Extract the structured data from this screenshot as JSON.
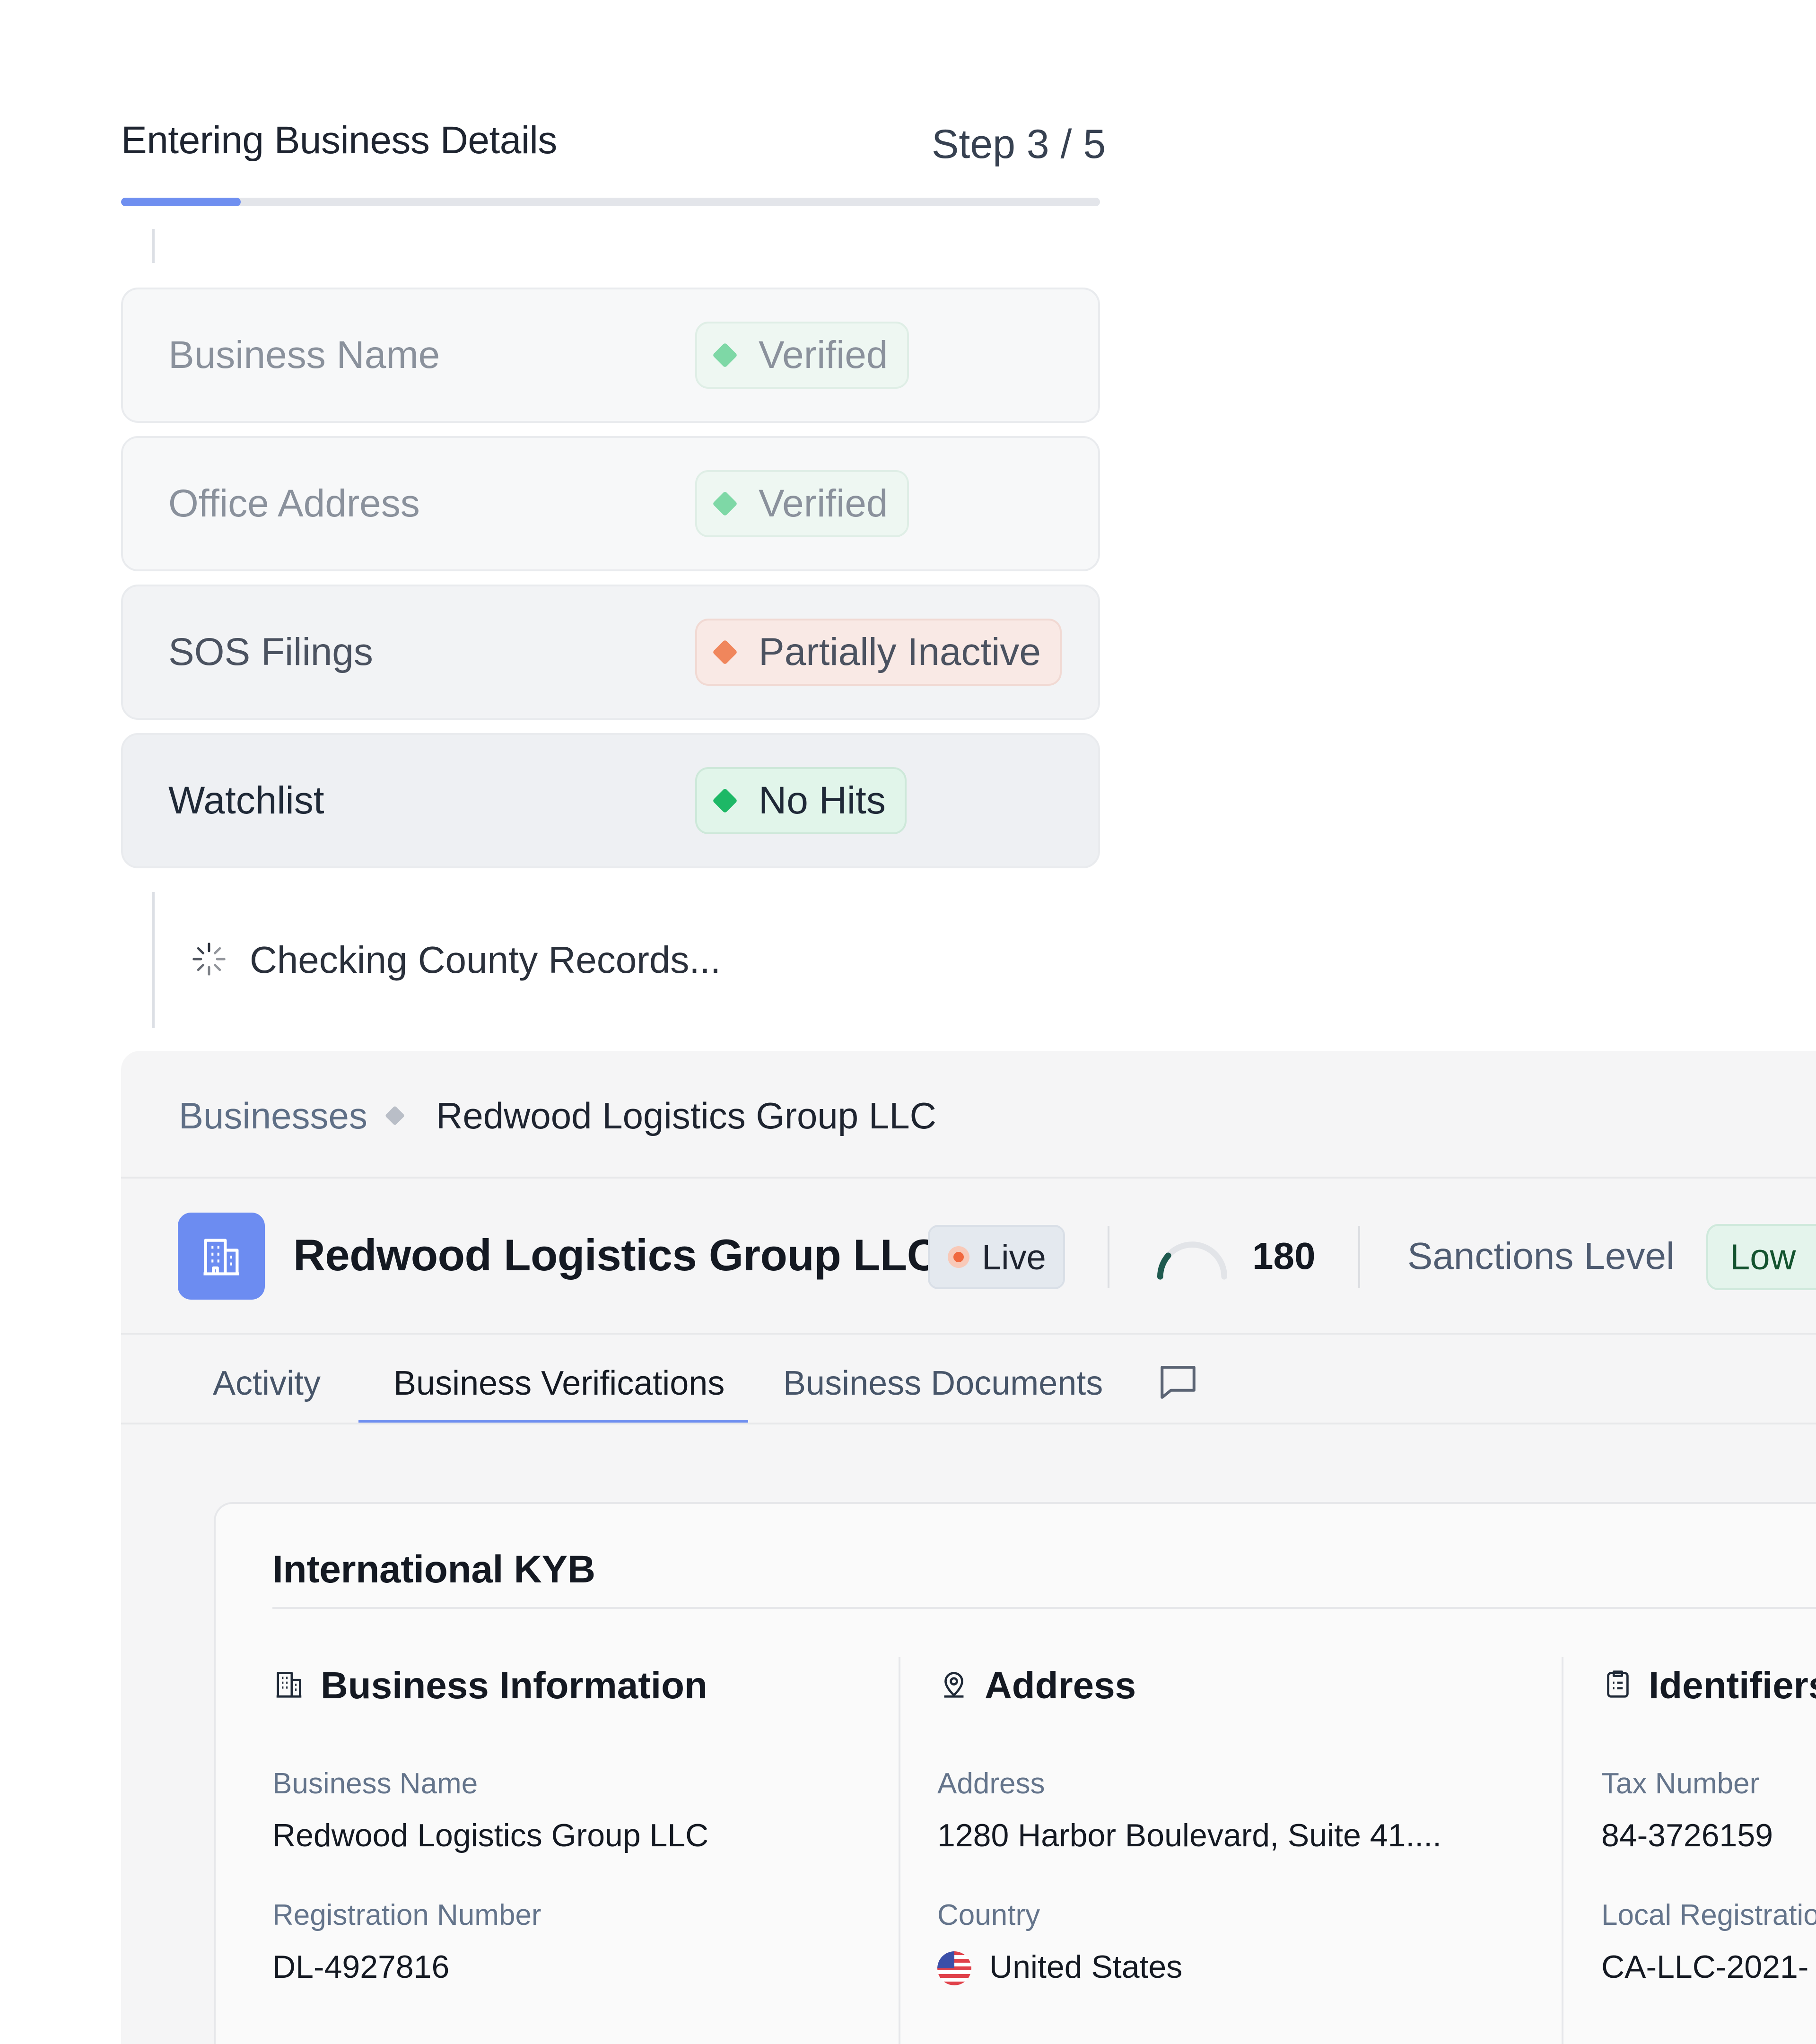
{
  "progress": {
    "title": "Entering Business Details",
    "step_label": "Step 3 / 5",
    "fraction": 0.122
  },
  "checks": [
    {
      "label": "Business Name",
      "status": "Verified"
    },
    {
      "label": "Office Address",
      "status": "Verified"
    },
    {
      "label": "SOS Filings",
      "status": "Partially Inactive"
    },
    {
      "label": "Watchlist",
      "status": "No Hits"
    }
  ],
  "checking_text": "Checking County Records...",
  "breadcrumb": {
    "parent": "Businesses",
    "current": "Redwood Logistics Group LLC"
  },
  "business": {
    "name": "Redwood Logistics Group LLC",
    "status": "Live",
    "score": "180",
    "sanctions_label": "Sanctions Level",
    "sanctions_value": "Low"
  },
  "tabs": [
    {
      "label": "Activity"
    },
    {
      "label": "Business Verifications"
    },
    {
      "label": "Business Documents"
    }
  ],
  "card": {
    "title": "International KYB",
    "business_info": {
      "title": "Business Information",
      "name_label": "Business Name",
      "name_value": "Redwood Logistics Group LLC",
      "reg_label": "Registration Number",
      "reg_value": "DL-4927816"
    },
    "address": {
      "title": "Address",
      "address_label": "Address",
      "address_value": "1280 Harbor Boulevard, Suite 41....",
      "country_label": "Country",
      "country_value": "United States"
    },
    "identifiers": {
      "title": "Identifiers",
      "tax_label": "Tax Number",
      "tax_value": "84-3726159",
      "local_label": "Local Registratio",
      "local_value": "CA-LLC-2021-"
    }
  },
  "colors": {
    "accent": "#6f8ff0",
    "verified": "#1db866",
    "warning": "#f0865c",
    "live": "#f0683e"
  }
}
